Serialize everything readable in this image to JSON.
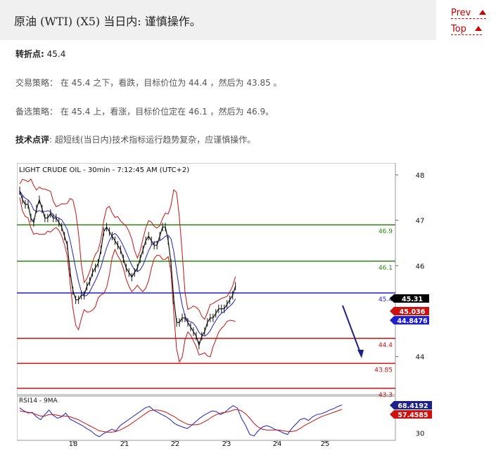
{
  "page": {
    "title": "原油 (WTI) (X5) 当日内: 谨慎操作。",
    "nav": {
      "prev": "Prev",
      "top": "Top"
    },
    "pivot_label": "转折点:",
    "pivot_value": "45.4",
    "strategy_label": "交易策略：",
    "strategy_text": "在 45.4 之下，看跌，目标价位为 44.4 ，然后为 43.85 。",
    "alt_label": "备选策略：",
    "alt_text": "在 45.4 上，看涨，目标价位定在 46.1 ，然后为 46.9。",
    "comment_label": "技术点评",
    "comment_text": ": 超短线(当日内)技术指标运行趋势复杂，应谨慎操作。"
  },
  "chart_data": [
    {
      "type": "line",
      "title": "LIGHT CRUDE OIL - 30min - 7:12:45 AM (UTC+2)",
      "y_ticks": [
        "48",
        "47",
        "46",
        "44"
      ],
      "ylim": [
        43.2,
        48.2
      ],
      "x_ticks": [
        "18",
        "21",
        "22",
        "23",
        "24",
        "25"
      ],
      "x": [
        0,
        4,
        8,
        12,
        16,
        20,
        24,
        28,
        32,
        36,
        40,
        44,
        48,
        52,
        56,
        60,
        64,
        68,
        72,
        76,
        80,
        84,
        88,
        92,
        96,
        100,
        104,
        108,
        112,
        116,
        120,
        124,
        128,
        132,
        136,
        140,
        144,
        148,
        152,
        156,
        160,
        164,
        168,
        172,
        176,
        180,
        184,
        188,
        192,
        196,
        200,
        204,
        208,
        212,
        216,
        220,
        224,
        228,
        232,
        236,
        240,
        244,
        248,
        252,
        256,
        260,
        264,
        268,
        272,
        276,
        280,
        284,
        288,
        292,
        296,
        300,
        304,
        308,
        312,
        316,
        320,
        324,
        328,
        332,
        336,
        340,
        344,
        348,
        352,
        356,
        360,
        364,
        368,
        372,
        376,
        380,
        384,
        388,
        392,
        396,
        400,
        404,
        408,
        412,
        416,
        420,
        424,
        428,
        432,
        436,
        440,
        444,
        448,
        452,
        456,
        460
      ],
      "series": [
        {
          "values": [
            47.65,
            47.45,
            47.35,
            47.35,
            47.05,
            46.95,
            47.25,
            47.45,
            47.25,
            47.05,
            47.05,
            47.15,
            47.05,
            47.05,
            46.95,
            46.85,
            46.65,
            46.45,
            45.85,
            45.45,
            45.25,
            45.25,
            45.35,
            45.35,
            45.55,
            45.65,
            45.85,
            45.95,
            46.05,
            46.35,
            46.75,
            46.85,
            46.75,
            46.65,
            46.55,
            46.45,
            46.35,
            46.15,
            45.95,
            45.85,
            45.75,
            45.85,
            45.95,
            46.15,
            46.35,
            46.55,
            46.65,
            46.55,
            46.45,
            46.45,
            46.65,
            46.85,
            46.85,
            46.55,
            46.05,
            45.25,
            44.75,
            44.75,
            44.85,
            44.85,
            44.75,
            44.65,
            44.55,
            44.45,
            44.25,
            44.45,
            44.55,
            44.75,
            44.85,
            44.85,
            44.95,
            45.05,
            45.05,
            45.05,
            45.15,
            45.25,
            45.35,
            45.55
          ],
          "note": "price"
        }
      ],
      "horizontal_levels": [
        {
          "value": 46.9,
          "label": "46.9",
          "color": "#2a8a0f"
        },
        {
          "value": 46.1,
          "label": "46.1",
          "color": "#2a8a0f"
        },
        {
          "value": 45.4,
          "label": "45.4",
          "color": "#1f1fcc"
        },
        {
          "value": 44.4,
          "label": "44.4",
          "color": "#cc1111"
        },
        {
          "value": 43.85,
          "label": "43.85",
          "color": "#cc1111"
        },
        {
          "value": 43.3,
          "label": "43.3",
          "color": "#cc1111"
        }
      ],
      "price_tags": [
        {
          "value": "45.31",
          "color": "#000000"
        },
        {
          "value": "45.036",
          "color": "#cc1111"
        },
        {
          "value": "44.8476",
          "color": "#1f1fcc"
        }
      ]
    },
    {
      "type": "line",
      "title": "RSI14 - 9MA",
      "y_ticks": [
        "30"
      ],
      "series": [
        {
          "values": [
            64,
            60,
            57,
            58,
            52,
            48,
            55,
            61,
            54,
            50,
            52,
            57,
            49,
            46,
            43,
            40,
            36,
            33,
            28,
            25,
            29,
            32,
            35,
            33,
            40,
            44,
            48,
            52,
            56,
            60,
            64,
            66,
            61,
            58,
            55,
            52,
            48,
            43,
            40,
            38,
            36,
            40,
            45,
            50,
            54,
            57,
            60,
            59,
            55,
            58,
            63,
            67,
            64,
            50,
            40,
            28,
            26,
            33,
            38,
            40,
            38,
            35,
            33,
            30,
            28,
            36,
            42,
            48,
            50,
            47,
            52,
            55,
            56,
            58,
            61,
            63,
            66,
            68
          ]
        },
        {
          "values": [
            60,
            59,
            58,
            57,
            55,
            53,
            53,
            55,
            55,
            54,
            53,
            53,
            52,
            50,
            48,
            45,
            42,
            39,
            36,
            33,
            32,
            31,
            31,
            32,
            34,
            37,
            40,
            44,
            48,
            52,
            56,
            60,
            61,
            61,
            60,
            58,
            55,
            52,
            48,
            45,
            42,
            41,
            41,
            42,
            45,
            48,
            52,
            55,
            57,
            58,
            59,
            61,
            62,
            60,
            56,
            50,
            43,
            38,
            35,
            34,
            34,
            34,
            34,
            33,
            32,
            32,
            33,
            36,
            40,
            43,
            46,
            49,
            52,
            54,
            56,
            58,
            60,
            62
          ]
        }
      ],
      "value_tags": [
        "68.4192",
        "57.4585"
      ]
    }
  ],
  "colors": {
    "accent": "#cc0000",
    "support": "#cc1111",
    "resistance": "#2a8a0f",
    "pivot": "#1f1fcc",
    "header_bg": "#f0f0f0"
  }
}
